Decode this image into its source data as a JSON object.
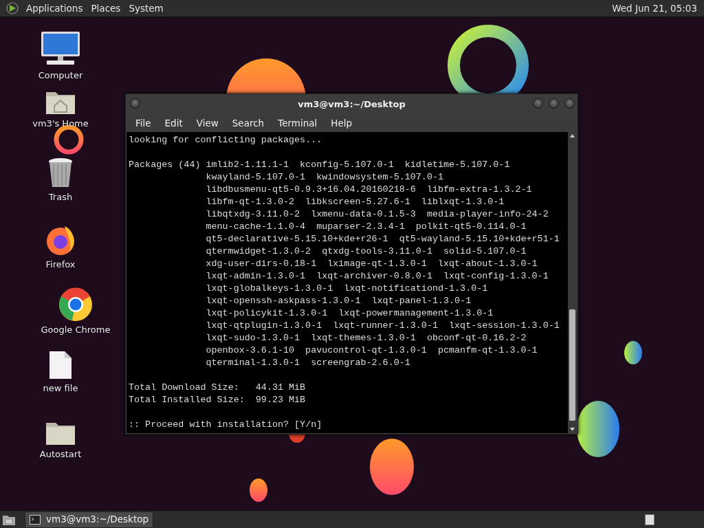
{
  "top_panel": {
    "menus": [
      "Applications",
      "Places",
      "System"
    ],
    "clock": "Wed Jun 21, 05:03"
  },
  "desktop_icons": [
    {
      "label": "Computer",
      "kind": "computer"
    },
    {
      "label": "vm3's Home",
      "kind": "home"
    },
    {
      "label": "Trash",
      "kind": "trash"
    },
    {
      "label": "Firefox",
      "kind": "firefox"
    },
    {
      "label": "Google Chrome",
      "kind": "chrome"
    },
    {
      "label": "new file",
      "kind": "file"
    },
    {
      "label": "Autostart",
      "kind": "folder"
    }
  ],
  "terminal": {
    "title": "vm3@vm3:~/Desktop",
    "menu": [
      "File",
      "Edit",
      "View",
      "Search",
      "Terminal",
      "Help"
    ],
    "blocks": [
      {
        "kind": "text",
        "lines": [
          "looking for conflicting packages..."
        ]
      },
      {
        "kind": "list",
        "heading": "Packages (44)",
        "lines": [
          "imlib2-1.11.1-1  kconfig-5.107.0-1  kidletime-5.107.0-1",
          "kwayland-5.107.0-1  kwindowsystem-5.107.0-1",
          "libdbusmenu-qt5-0.9.3+16.04.20160218-6  libfm-extra-1.3.2-1",
          "libfm-qt-1.3.0-2  libkscreen-5.27.6-1  liblxqt-1.3.0-1",
          "libqtxdg-3.11.0-2  lxmenu-data-0.1.5-3  media-player-info-24-2",
          "menu-cache-1.1.0-4  muparser-2.3.4-1  polkit-qt5-0.114.0-1",
          "qt5-declarative-5.15.10+kde+r26-1  qt5-wayland-5.15.10+kde+r51-1",
          "qtermwidget-1.3.0-2  qtxdg-tools-3.11.0-1  solid-5.107.0-1",
          "xdg-user-dirs-0.18-1  lximage-qt-1.3.0-1  lxqt-about-1.3.0-1",
          "lxqt-admin-1.3.0-1  lxqt-archiver-0.8.0-1  lxqt-config-1.3.0-1",
          "lxqt-globalkeys-1.3.0-1  lxqt-notificationd-1.3.0-1",
          "lxqt-openssh-askpass-1.3.0-1  lxqt-panel-1.3.0-1",
          "lxqt-policykit-1.3.0-1  lxqt-powermanagement-1.3.0-1",
          "lxqt-qtplugin-1.3.0-1  lxqt-runner-1.3.0-1  lxqt-session-1.3.0-1",
          "lxqt-sudo-1.3.0-1  lxqt-themes-1.3.0-1  obconf-qt-0.16.2-2",
          "openbox-3.6.1-10  pavucontrol-qt-1.3.0-1  pcmanfm-qt-1.3.0-1",
          "qterminal-1.3.0-1  screengrab-2.6.0-1"
        ]
      },
      {
        "kind": "text",
        "lines": [
          "Total Download Size:   44.31 MiB",
          "Total Installed Size:  99.23 MiB"
        ]
      },
      {
        "kind": "text",
        "lines": [
          ":: Proceed with installation? [Y/n]"
        ]
      }
    ]
  },
  "taskbar": {
    "tasks": [
      {
        "label": "vm3@vm3:~/Desktop",
        "selected": true
      }
    ]
  }
}
